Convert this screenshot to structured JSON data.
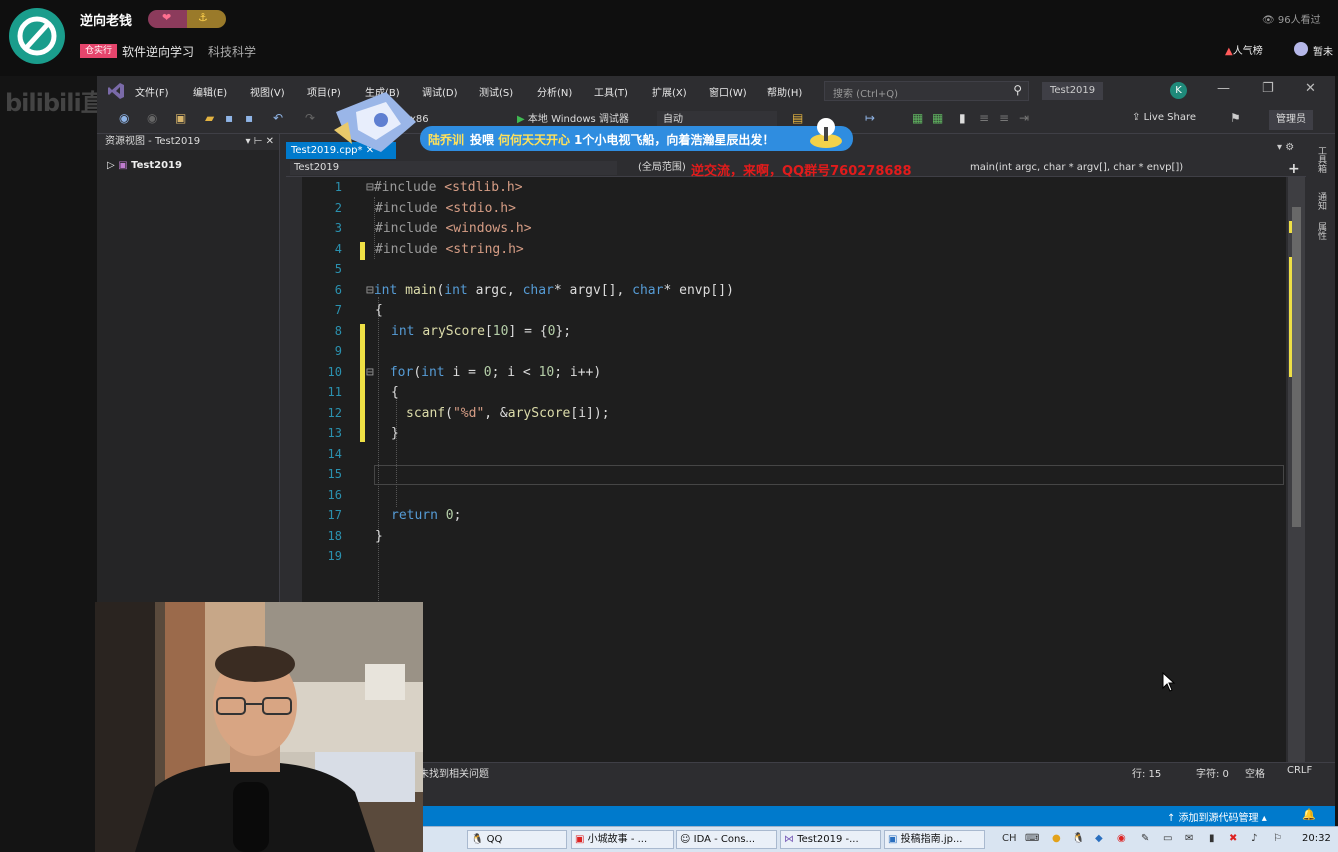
{
  "stream": {
    "streamer_name": "逆向老钱",
    "area_tag": "仓实行",
    "area_name": "软件逆向学习",
    "category": "科技科学",
    "viewers": "96人看过",
    "popularity": "人气榜",
    "notification": "暂未",
    "platform_logo": "bilibili直播",
    "badge_icons": [
      "heart-icon",
      "anchor-icon"
    ]
  },
  "vs": {
    "menu": [
      "文件(F)",
      "编辑(E)",
      "视图(V)",
      "项目(P)",
      "生成(B)",
      "调试(D)",
      "测试(S)",
      "分析(N)",
      "工具(T)",
      "扩展(X)",
      "窗口(W)",
      "帮助(H)"
    ],
    "search_placeholder": "搜索 (Ctrl+Q)",
    "solution_title": "Test2019",
    "account_initial": "K",
    "toolbar": {
      "platform": "x86",
      "run_label": "本地 Windows 调试器",
      "run_mode": "自动",
      "live_share": "Live Share",
      "admin": "管理员"
    },
    "explorer": {
      "title": "资源视图 - Test2019",
      "controls": "▾ ⊢ ✕",
      "root": "Test2019"
    },
    "tab": "Test2019.cpp* ✕",
    "nav": {
      "project": "Test2019",
      "scope": "(全局范围)",
      "member": "main(int argc, char * argv[], char * envp[])"
    },
    "side_tabs": [
      "工具箱",
      "通知",
      "属性"
    ],
    "line_numbers": [
      "1",
      "2",
      "3",
      "4",
      "5",
      "6",
      "7",
      "8",
      "9",
      "10",
      "11",
      "12",
      "13",
      "14",
      "15",
      "16",
      "17",
      "18",
      "19"
    ],
    "code": {
      "l1_kw": "#include",
      "l1_inc": "<stdlib.h>",
      "l2_kw": "#include",
      "l2_inc": "<stdio.h>",
      "l3_kw": "#include",
      "l3_inc": "<windows.h>",
      "l4_kw": "#include",
      "l4_inc": "<string.h>",
      "l6_int": "int",
      "l6_main": "main",
      "l6_a": "(",
      "l6_int2": "int",
      "l6_b": " argc, ",
      "l6_char": "char",
      "l6_c": "* argv[], ",
      "l6_char2": "char",
      "l6_d": "* envp[])",
      "l7": "{",
      "l8_int": "int",
      "l8_var": "aryScore",
      "l8_a": "[",
      "l8_n": "10",
      "l8_b": "] = {",
      "l8_n2": "0",
      "l8_c": "};",
      "l10_for": "for",
      "l10_a": "(",
      "l10_int": "int",
      "l10_b": " i = ",
      "l10_n0": "0",
      "l10_c": "; i < ",
      "l10_n10": "10",
      "l10_d": "; i++)",
      "l11": "{",
      "l12_fn": "scanf",
      "l12_a": "(",
      "l12_str": "\"%d\"",
      "l12_b": ", &",
      "l12_var": "aryScore",
      "l12_c": "[i]);",
      "l13": "}",
      "l17_ret": "return",
      "l17_n": "0",
      "l17_end": ";",
      "l18": "}"
    },
    "status": {
      "issues": "未找到相关问题",
      "line": "行: 15",
      "char": "字符: 0",
      "ins": "空格",
      "eol": "CRLF",
      "source_control": "↑ 添加到源代码管理 ▴"
    }
  },
  "taskbar": {
    "tasks": [
      "QQ",
      "小城故事 - ...",
      "IDA - Cons...",
      "Test2019 -...",
      "投稿指南.jp..."
    ],
    "ime": "CH",
    "clock": "20:32"
  },
  "overlay": {
    "gift_user": "陆乔训",
    "gift_verb": "投喂",
    "gift_target": "何何天天开心",
    "gift_rest": "1个小电视飞船，向着浩瀚星辰出发！",
    "ticker": "逆交流，来啊，QQ群号760278688"
  },
  "colors": {
    "vs_blue": "#007acc",
    "editor_bg": "#1e1e1e",
    "keyword": "#569cd6",
    "change_marker": "#efe045",
    "ticker_red": "#e21b1b"
  }
}
